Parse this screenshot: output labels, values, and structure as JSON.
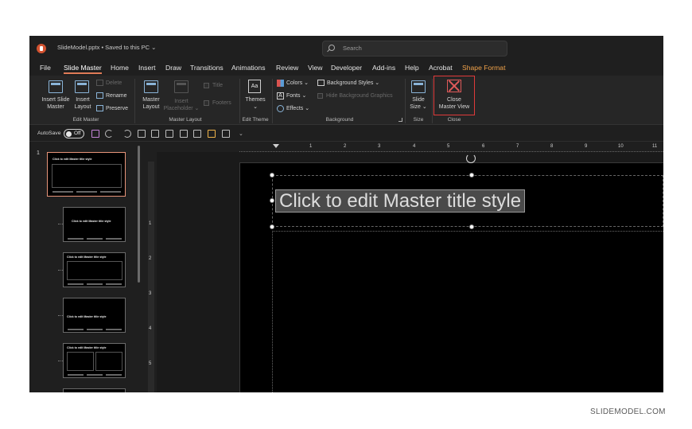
{
  "titlebar": {
    "doc_title": "SlideModel.pptx • Saved to this PC ⌄",
    "search_placeholder": "Search"
  },
  "menu": [
    "File",
    "Slide Master",
    "Home",
    "Insert",
    "Draw",
    "Transitions",
    "Animations",
    "Review",
    "View",
    "Developer",
    "Add-ins",
    "Help",
    "Acrobat",
    "Shape Format"
  ],
  "ribbon": {
    "insert_slide_master": [
      "Insert Slide",
      "Master"
    ],
    "insert_layout": [
      "Insert",
      "Layout"
    ],
    "delete": "Delete",
    "rename": "Rename",
    "preserve": "Preserve",
    "edit_master_group": "Edit Master",
    "master_layout": [
      "Master",
      "Layout"
    ],
    "insert_placeholder": [
      "Insert",
      "Placeholder ⌄"
    ],
    "title_chk": "Title",
    "footers_chk": "Footers",
    "master_layout_group": "Master Layout",
    "themes": "Themes",
    "themes_caret": "⌄",
    "edit_theme_group": "Edit Theme",
    "colors": "Colors ⌄",
    "fonts": "Fonts ⌄",
    "effects": "Effects ⌄",
    "background_styles": "Background Styles ⌄",
    "hide_background": "Hide Background Graphics",
    "background_group": "Background",
    "slide_size": [
      "Slide",
      "Size ⌄"
    ],
    "size_group": "Size",
    "close_master_view": [
      "Close",
      "Master View"
    ],
    "close_group": "Close"
  },
  "qat": {
    "autosave": "AutoSave",
    "toggle": "Off"
  },
  "panel": {
    "slide_number": "1",
    "thumb_title": "Click to edit Master title style"
  },
  "ruler": {
    "h_numbers": [
      "1",
      "2",
      "3",
      "4",
      "5",
      "6",
      "7",
      "8",
      "9",
      "10",
      "11"
    ],
    "v_numbers": [
      "1",
      "2",
      "3",
      "4",
      "5"
    ]
  },
  "slide": {
    "title_placeholder": "Click to edit Master title style"
  },
  "watermark": "SLIDEMODEL.COM"
}
